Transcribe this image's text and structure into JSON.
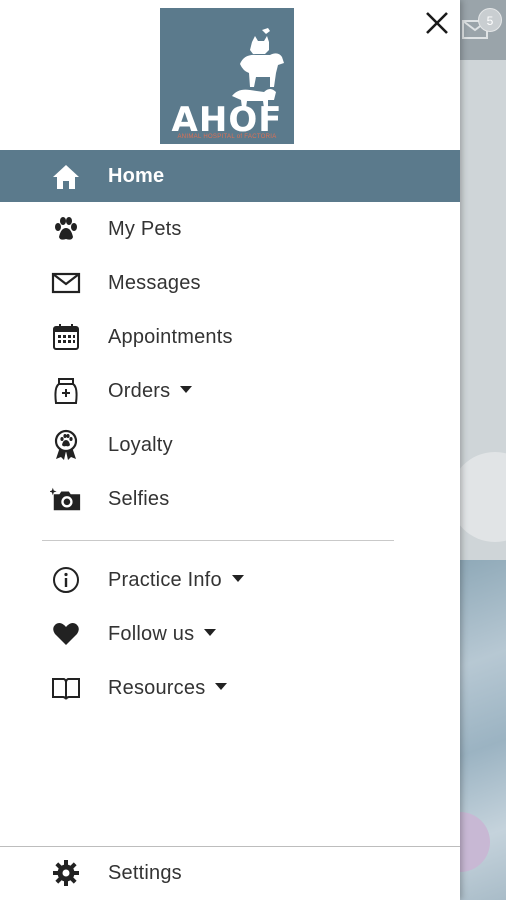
{
  "drawer": {
    "logo": {
      "brand": "AHOF",
      "tagline": "ANIMAL HOSPITAL of FACTORIA"
    },
    "close_icon": "close-icon",
    "primary_items": [
      {
        "label": "Home",
        "icon": "home-icon",
        "active": true
      },
      {
        "label": "My Pets",
        "icon": "paw-icon"
      },
      {
        "label": "Messages",
        "icon": "envelope-icon"
      },
      {
        "label": "Appointments",
        "icon": "calendar-icon"
      },
      {
        "label": "Orders",
        "icon": "food-bag-icon",
        "has_dropdown": true
      },
      {
        "label": "Loyalty",
        "icon": "award-ribbon-icon"
      },
      {
        "label": "Selfies",
        "icon": "camera-icon"
      }
    ],
    "secondary_items": [
      {
        "label": "Practice Info",
        "icon": "info-icon",
        "has_dropdown": true
      },
      {
        "label": "Follow us",
        "icon": "heart-icon",
        "has_dropdown": true
      },
      {
        "label": "Resources",
        "icon": "book-icon",
        "has_dropdown": true
      }
    ],
    "footer_item": {
      "label": "Settings",
      "icon": "gear-icon"
    }
  },
  "background": {
    "message_badge": "5"
  },
  "colors": {
    "accent": "#5b7a8c",
    "logo_tagline": "#e06f53",
    "text": "#333333"
  }
}
